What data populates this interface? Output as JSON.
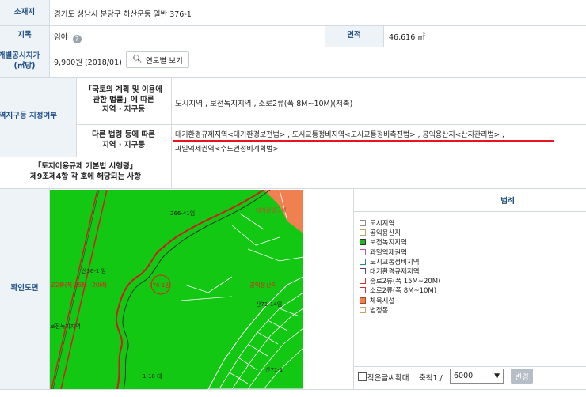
{
  "rows": {
    "location_label": "소재지",
    "location_value": "경기도 성남시 분당구 하산운동 일반 376-1",
    "jimok_label": "지목",
    "jimok_value": "임야",
    "area_label": "면적",
    "area_value": "46,616 ㎡",
    "price_label_1": "개별공시지가",
    "price_label_2": "(㎡당)",
    "price_value": "9,900원 (2018/01)",
    "year_button": "연도별 보기",
    "zone_label": "지역지구등 지정여부",
    "nat_law_label_1": "「국토의 계획 및 이용에",
    "nat_law_label_2": "관한 법률」에 따른",
    "nat_law_label_3": "지역 · 지구등",
    "nat_law_value": "도시지역 , 보전녹지지역 , 소로2류(폭 8M~10M)(저촉)",
    "other_law_label_1": "다른 법령 등에 따른",
    "other_law_label_2": "지역 · 지구등",
    "other_law_value_1": "대기환경규제지역<대기환경보전법> , 도시교통정비지역<도시교통정비촉진법> , 공익용산지<산지관리법> ,",
    "other_law_value_2": "과밀억제권역<수도권정비계획법>",
    "decree_label_1": "「토지이용규제 기본법 시행령」",
    "decree_label_2": "제9조제4항 각 호에 해당되는 사항",
    "map_label": "확인도면"
  },
  "map": {
    "labels": {
      "l1": "266-41임",
      "l2": "산36-1 임",
      "l3": "로2류(폭 15M~20M)",
      "l4": "376-1임",
      "l5": "공익용산지",
      "l6": "산71-14임",
      "l7": "보전녹지지역",
      "l8": "1-18 대",
      "l9": "대기환경규제",
      "l10": "산71-1"
    }
  },
  "legend": {
    "title": "범례",
    "items": [
      {
        "label": "도시지역",
        "color": "#ffffff",
        "border": "#8c8c8c"
      },
      {
        "label": "공익용산지",
        "color": "#ffffff",
        "border": "#c8a06a"
      },
      {
        "label": "보전녹지지역",
        "color": "#1fb81f",
        "border": "#333333"
      },
      {
        "label": "과밀억제권역",
        "color": "#ffffff",
        "border": "#b05aa0"
      },
      {
        "label": "도시교통정비지역",
        "color": "#ffffff",
        "border": "#2a8a8a"
      },
      {
        "label": "대기환경규제지역",
        "color": "#ffffff",
        "border": "#5a3a9a"
      },
      {
        "label": "중로2류(폭 15M~20M)",
        "color": "#ffffff",
        "border": "#d03030"
      },
      {
        "label": "소로2류(폭 8M~10M)",
        "color": "#ffffff",
        "border": "#d03030"
      },
      {
        "label": "체육시설",
        "color": "#f08050",
        "border": "#a04a20"
      },
      {
        "label": "법정동",
        "color": "#ffffff",
        "border": "#c8a06a"
      }
    ]
  },
  "controls": {
    "small_text_label": "작은글씨확대",
    "scale_label": "축척1 /",
    "scale_value": "6000",
    "change_button": "변경"
  },
  "colors": {
    "header_bg": "#eef3f8",
    "header_text": "#1f4f86",
    "map_green": "#12c812",
    "sports_orange": "#f08050",
    "red_underline": "#e8141e"
  }
}
